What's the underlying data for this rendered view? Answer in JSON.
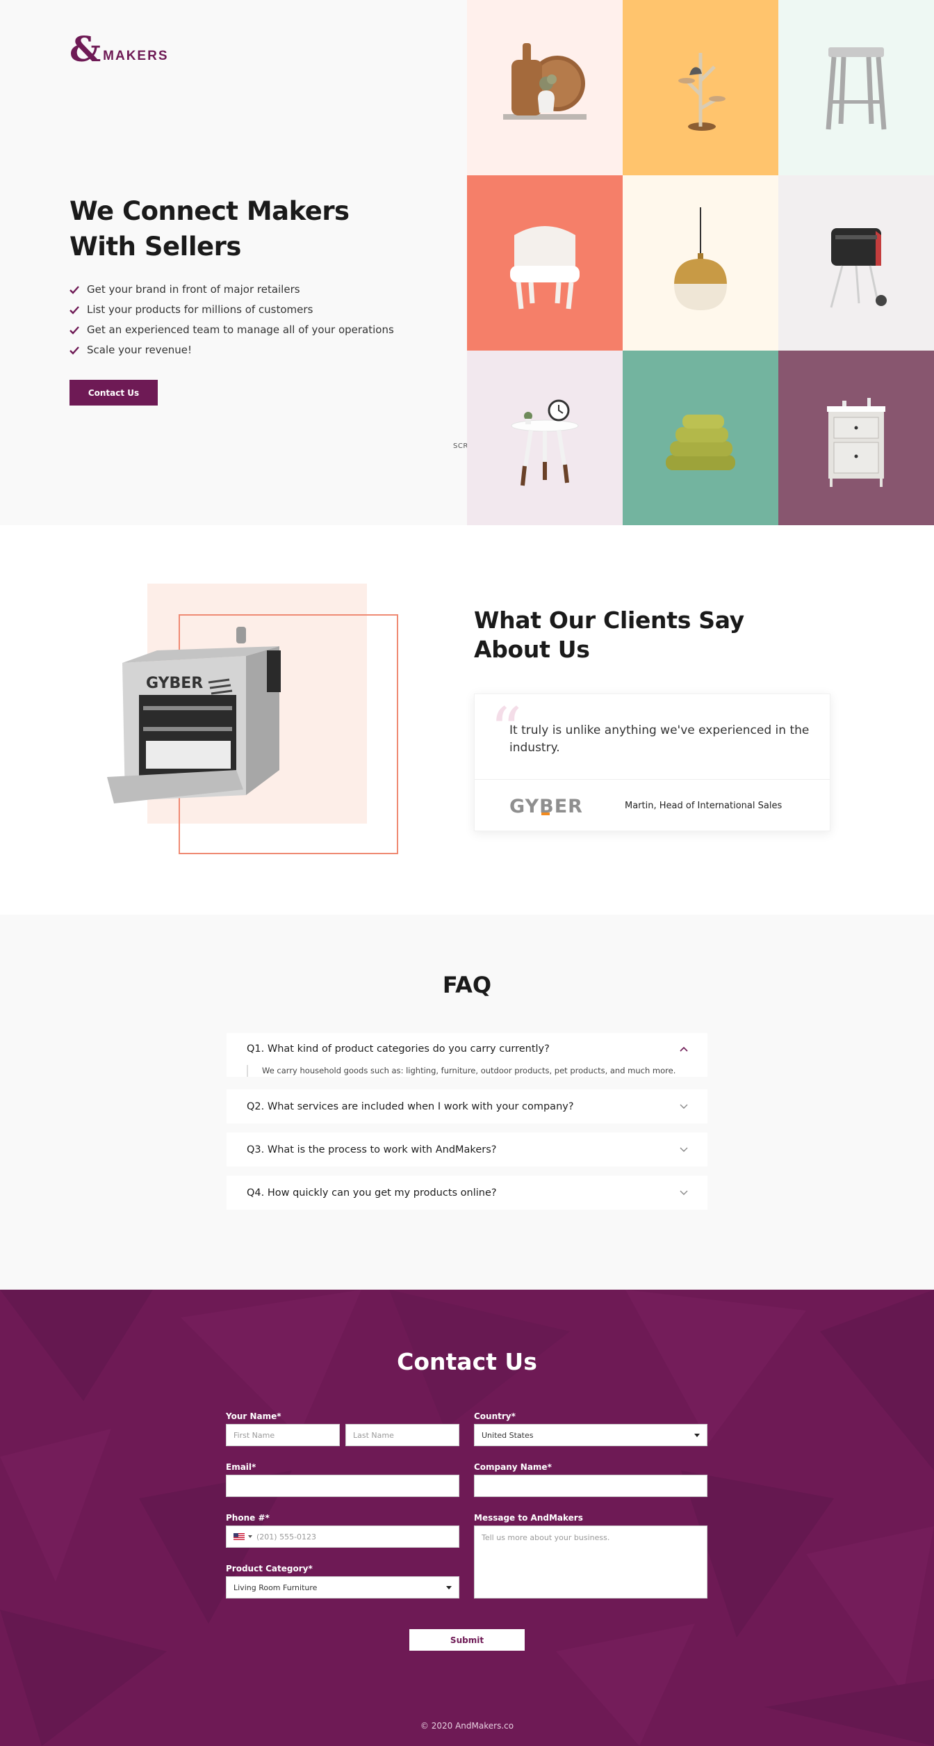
{
  "brand": {
    "symbol": "&",
    "word": "MAKERS"
  },
  "hero": {
    "title_line1": "We Connect Makers",
    "title_line2": "With Sellers",
    "bullets": [
      "Get your brand in front of major retailers",
      "List your products for millions of customers",
      "Get an experienced team to manage all of your operations",
      "Scale your revenue!"
    ],
    "cta_label": "Contact Us",
    "scroll_label": "SCROLL"
  },
  "product_tiles": [
    {
      "name": "cutting-boards",
      "bg": "#fff0ec"
    },
    {
      "name": "cat-tree",
      "bg": "#ffc46d"
    },
    {
      "name": "stool",
      "bg": "#eef8f3"
    },
    {
      "name": "armchair",
      "bg": "#f57f69"
    },
    {
      "name": "pendant-lamp",
      "bg": "#fff8ec"
    },
    {
      "name": "grill",
      "bg": "#f2eff0"
    },
    {
      "name": "side-table",
      "bg": "#f2e8ee"
    },
    {
      "name": "towels",
      "bg": "#73b49f"
    },
    {
      "name": "nightstand",
      "bg": "#88566f"
    }
  ],
  "testimonial": {
    "title_line1": "What Our Clients Say",
    "title_line2": "About Us",
    "quote": "It truly is unlike anything we've experienced in the industry.",
    "author": "Martin, Head of International Sales",
    "logo_text": "GYBER",
    "product_brand": "GYBER"
  },
  "faq": {
    "title": "FAQ",
    "items": [
      {
        "question": "Q1. What kind of product categories do you carry currently?",
        "answer": "We carry household goods such as: lighting, furniture, outdoor products, pet products, and much more."
      },
      {
        "question": "Q2. What services are included when I work with your company?"
      },
      {
        "question": "Q3. What is the process to work with AndMakers?"
      },
      {
        "question": "Q4. How quickly can you get my products online?"
      }
    ]
  },
  "contact": {
    "title": "Contact Us",
    "name_label": "Your Name*",
    "first_name_placeholder": "First Name",
    "last_name_placeholder": "Last Name",
    "country_label": "Country*",
    "country_value": "United States",
    "email_label": "Email*",
    "company_label": "Company Name*",
    "phone_label": "Phone #*",
    "phone_placeholder": "(201) 555-0123",
    "message_label": "Message to AndMakers",
    "message_placeholder": "Tell us more about your business.",
    "category_label": "Product Category*",
    "category_value": "Living Room Furniture",
    "submit_label": "Submit"
  },
  "footer": {
    "copyright": "© 2020 AndMakers.co"
  },
  "colors": {
    "brand": "#6e1a55",
    "accent": "#ef8a73"
  }
}
